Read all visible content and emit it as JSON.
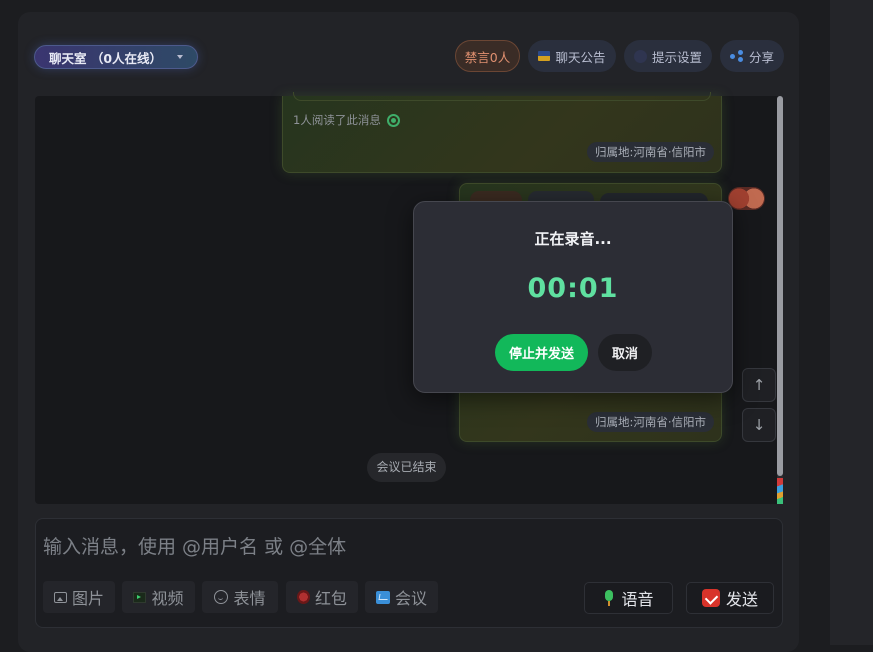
{
  "header": {
    "room_label": "聊天室 （0人在线）",
    "mute_label": "禁言0人",
    "notice_label": "聊天公告",
    "tips_label": "提示设置",
    "share_label": "分享"
  },
  "messages": {
    "read_status": "1人阅读了此消息",
    "location_1": "归属地:河南省·信阳市",
    "location_2": "归属地:河南省·信阳市",
    "meeting_ended": "会议已结束"
  },
  "nav": {
    "up": "↑",
    "down": "↓"
  },
  "recording_modal": {
    "title": "正在录音...",
    "timer": "00:01",
    "stop_send": "停止并发送",
    "cancel": "取消"
  },
  "composer": {
    "placeholder": "输入消息，使用 @用户名 或 @全体",
    "tools": {
      "image": "图片",
      "video": "视频",
      "emoji": "表情",
      "red_packet": "红包",
      "meeting": "会议"
    },
    "voice": "语音",
    "send": "发送"
  },
  "colors": {
    "accent_green": "#12b85a",
    "timer_green": "#5fe0a0",
    "mute_orange": "#e09070"
  }
}
